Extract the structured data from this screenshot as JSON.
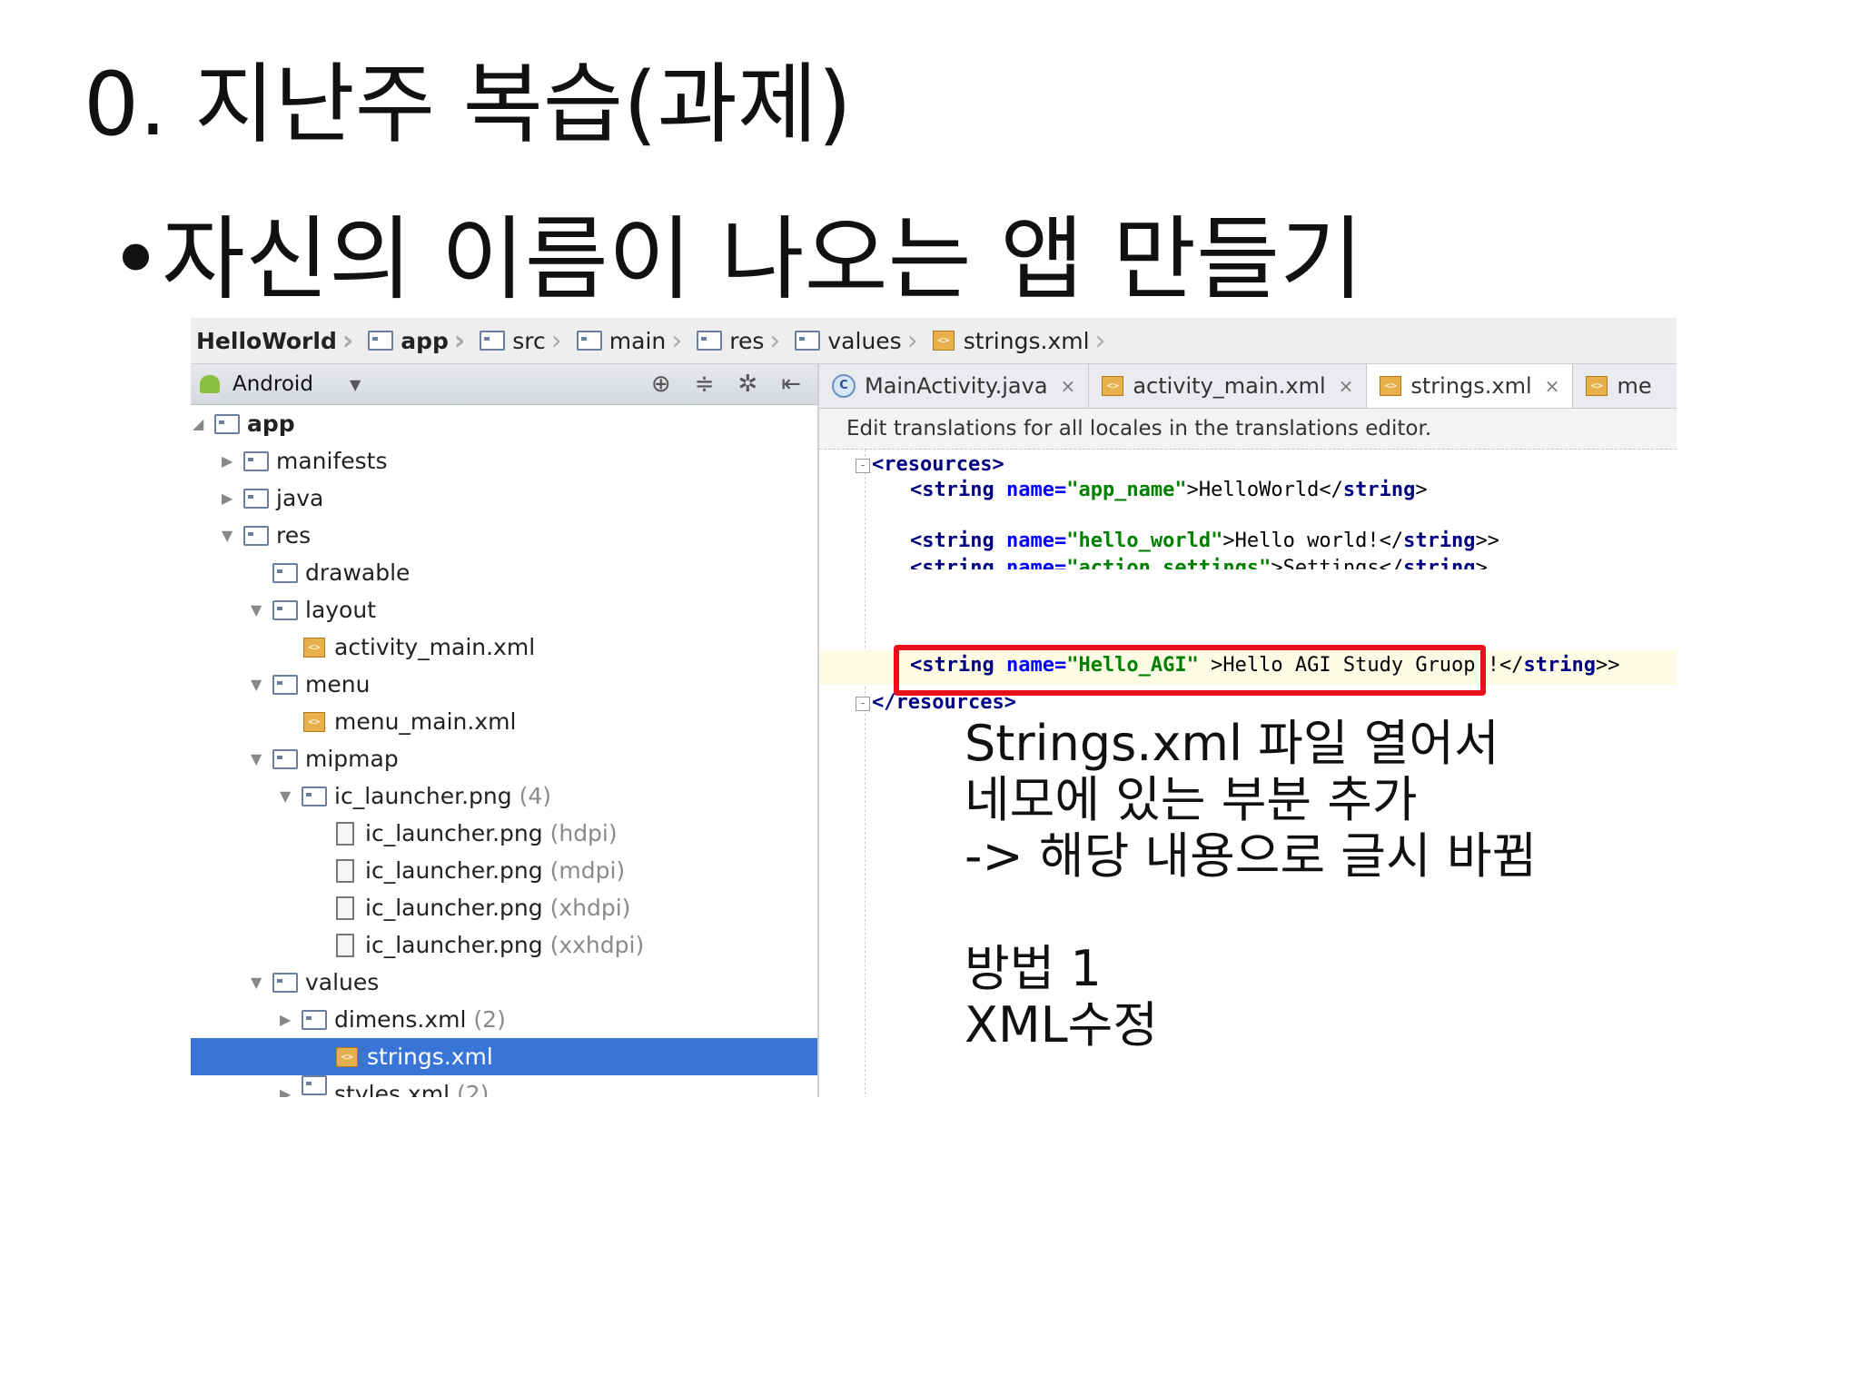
{
  "slide": {
    "title": "0. 지난주 복습(과제)",
    "bullet_char": "•",
    "bullet": "자신의 이름이 나오는 앱 만들기"
  },
  "ide": {
    "breadcrumbs": [
      {
        "label": "HelloWorld",
        "icon": ""
      },
      {
        "label": "app",
        "icon": "module-folder-icon"
      },
      {
        "label": "src",
        "icon": "folder-icon"
      },
      {
        "label": "main",
        "icon": "folder-icon"
      },
      {
        "label": "res",
        "icon": "res-folder-icon"
      },
      {
        "label": "values",
        "icon": "folder-icon"
      },
      {
        "label": "strings.xml",
        "icon": "xml-file-icon"
      }
    ],
    "project_view": "Android",
    "tree": [
      {
        "label": "app",
        "suffix": "",
        "expanded": true
      },
      {
        "label": "manifests",
        "suffix": ""
      },
      {
        "label": "java",
        "suffix": ""
      },
      {
        "label": "res",
        "suffix": ""
      },
      {
        "label": "drawable",
        "suffix": ""
      },
      {
        "label": "layout",
        "suffix": ""
      },
      {
        "label": "activity_main.xml",
        "suffix": ""
      },
      {
        "label": "menu",
        "suffix": ""
      },
      {
        "label": "menu_main.xml",
        "suffix": ""
      },
      {
        "label": "mipmap",
        "suffix": ""
      },
      {
        "label": "ic_launcher.png",
        "suffix": "(4)"
      },
      {
        "label": "ic_launcher.png",
        "suffix": "(hdpi)"
      },
      {
        "label": "ic_launcher.png",
        "suffix": "(mdpi)"
      },
      {
        "label": "ic_launcher.png",
        "suffix": "(xhdpi)"
      },
      {
        "label": "ic_launcher.png",
        "suffix": "(xxhdpi)"
      },
      {
        "label": "values",
        "suffix": ""
      },
      {
        "label": "dimens.xml",
        "suffix": "(2)"
      },
      {
        "label": "strings.xml",
        "suffix": "",
        "selected": true
      },
      {
        "label": "styles.xml",
        "suffix": "(2)"
      }
    ],
    "tabs": [
      {
        "label": "MainActivity.java",
        "close": "×"
      },
      {
        "label": "activity_main.xml",
        "close": "×"
      },
      {
        "label": "strings.xml",
        "close": "×",
        "active": true
      },
      {
        "label": "me",
        "close": ""
      }
    ],
    "notice": "Edit translations for all locales in the translations editor.",
    "code": {
      "resources_open": "<resources>",
      "line1": {
        "open": "<string",
        "attr": "name=",
        "val": "\"app_name\"",
        "text": ">HelloWorld</",
        "tag": "string",
        "end": ">"
      },
      "line2": {
        "open": "<string",
        "attr": "name=",
        "val": "\"hello_world\"",
        "text": ">Hello world!</",
        "tag": "string",
        "end": ">>"
      },
      "line3": {
        "open": "<string",
        "attr": "name=",
        "val": "\"action_settings\"",
        "text": ">Settings</",
        "tag": "string",
        "end": ">"
      },
      "line4": {
        "open": "<string",
        "attr": "name=",
        "val": "\"Hello_AGI\"",
        "text": " >Hello AGI Study Gruop!!</",
        "tag": "string",
        "end": ">>"
      },
      "resources_close": "</resources>"
    },
    "highlight_color": "#e8101a"
  },
  "annotation": {
    "lines": [
      "Strings.xml 파일 열어서",
      "네모에 있는 부분 추가",
      "-> 해당 내용으로 글시 바뀜",
      "",
      "방법 1",
      "XML수정"
    ]
  }
}
